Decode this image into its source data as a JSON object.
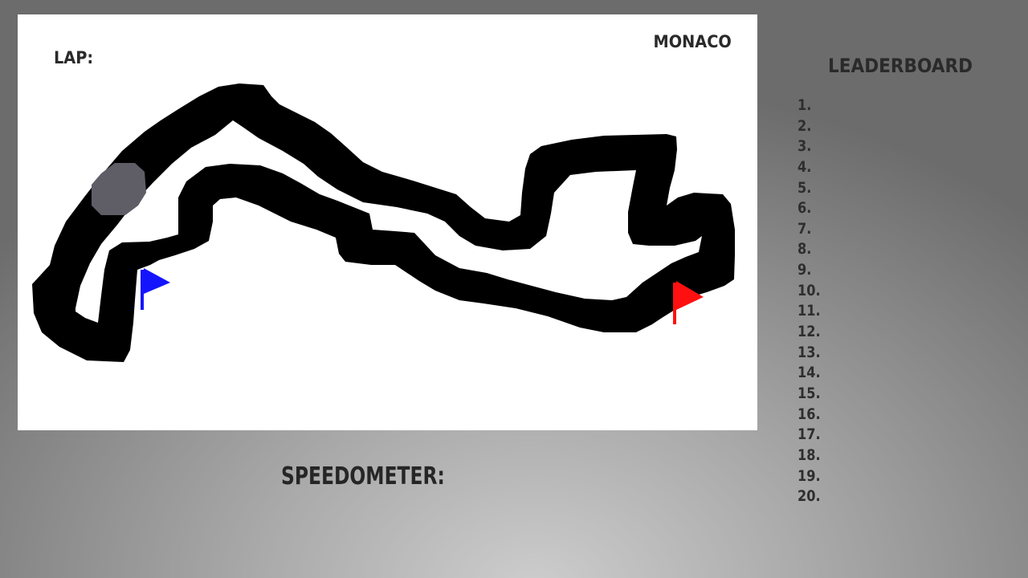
{
  "hud": {
    "lap_label": "LAP:",
    "track_name": "MONACO",
    "speedometer_label": "SPEEDOMETER:"
  },
  "leaderboard": {
    "title": "LEADERBOARD",
    "positions": [
      "1.",
      "2.",
      "3.",
      "4.",
      "5.",
      "6.",
      "7.",
      "8.",
      "9.",
      "10.",
      "11.",
      "12.",
      "13.",
      "14.",
      "15.",
      "16.",
      "17.",
      "18.",
      "19.",
      "20."
    ]
  },
  "track": {
    "start_flag_color": "#1414ff",
    "finish_flag_color": "#ff1010",
    "surface_color": "#000000",
    "pit_color": "#5f5d66"
  }
}
